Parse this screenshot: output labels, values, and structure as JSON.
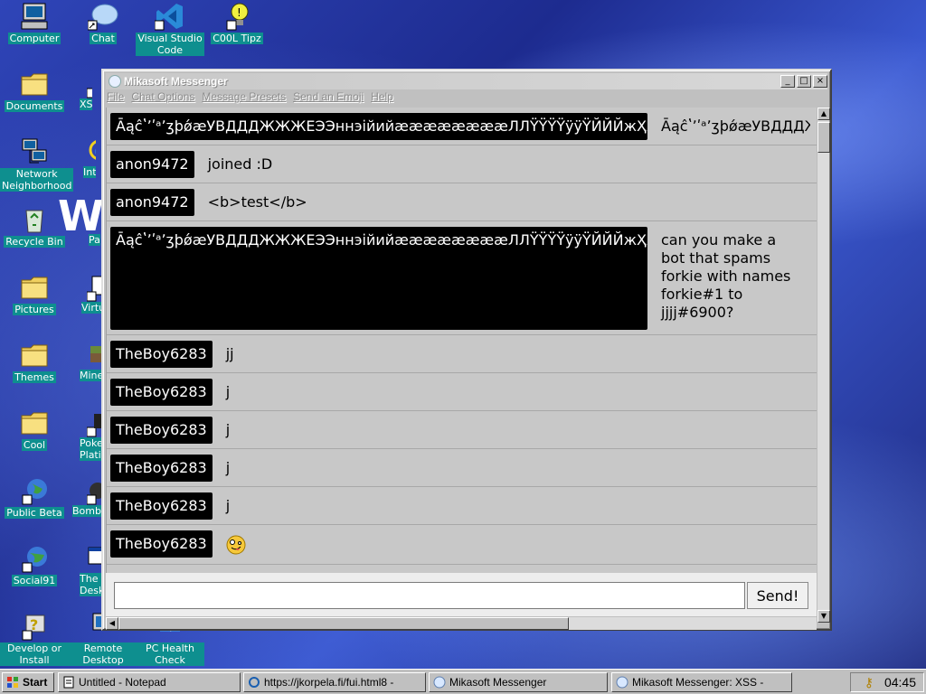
{
  "desktop": {
    "icons": [
      {
        "label": "Computer",
        "icon": "computer-icon"
      },
      {
        "label": "Chat",
        "icon": "chat-icon"
      },
      {
        "label": "Visual Studio Code",
        "icon": "vscode-icon"
      },
      {
        "label": "C00L Tipz",
        "icon": "tips-icon"
      },
      {
        "label": "Documents",
        "icon": "folder-icon"
      },
      {
        "label": "XSS",
        "icon": "chat-icon"
      },
      {
        "label": "Network Neighborhood",
        "icon": "network-icon"
      },
      {
        "label": "Inte Explo",
        "icon": "internet-explorer-icon"
      },
      {
        "label": "Recycle Bin",
        "icon": "recycle-bin-icon"
      },
      {
        "label": "Pa",
        "icon": "paint-icon"
      },
      {
        "label": "Pictures",
        "icon": "folder-icon"
      },
      {
        "label": "Virtu",
        "icon": "app-icon"
      },
      {
        "label": "Themes",
        "icon": "folder-icon"
      },
      {
        "label": "Mine",
        "icon": "minecraft-icon"
      },
      {
        "label": "Cool",
        "icon": "folder-icon"
      },
      {
        "label": "Poke Plati",
        "icon": "app-icon"
      },
      {
        "label": "Public Beta",
        "icon": "globe-icon"
      },
      {
        "label": "Bomb",
        "icon": "bomb-icon"
      },
      {
        "label": "Social91",
        "icon": "globe-icon"
      },
      {
        "label": "The Desk",
        "icon": "app-icon"
      },
      {
        "label": "Develop or Install",
        "icon": "setup-icon"
      },
      {
        "label": "Remote Desktop",
        "icon": "remote-desktop-icon"
      },
      {
        "label": "PC Health Check",
        "icon": "health-check-icon"
      }
    ]
  },
  "window": {
    "title": "Mikasoft Messenger",
    "menu": [
      "File",
      "Chat Options",
      "Message Presets",
      "Send an Emoji",
      "Help"
    ],
    "messages": [
      {
        "user": "ĀąĉʽʼʹᵃʼʒþǿæУВДДДЖЖЖЕЭЭннэійийææææææææЛЛŸŸŸŸÿÿŸЙЙЙжҲҲҲҲҲ",
        "text": "ĀąĉʽʼʹᵃʼʒþǿæУВДДДЖЖЖ"
      },
      {
        "user": "anon9472",
        "text": "joined :D"
      },
      {
        "user": "anon9472",
        "text": "<b>test</b>"
      },
      {
        "user": "ĀąĉʽʼʹᵃʼʒþǿæУВДДДЖЖЖЕЭЭннэійийææææææææЛЛŸŸŸŸÿÿŸЙЙЙжҲҲҲҲҲ",
        "text": "can you make a bot that spams forkie with names forkie#1 to jjjj#6900?"
      },
      {
        "user": "TheBoy6283",
        "text": "jj"
      },
      {
        "user": "TheBoy6283",
        "text": "j"
      },
      {
        "user": "TheBoy6283",
        "text": "j"
      },
      {
        "user": "TheBoy6283",
        "text": "j"
      },
      {
        "user": "TheBoy6283",
        "text": "j"
      },
      {
        "user": "TheBoy6283",
        "text": "",
        "emoji": "zany-face-emoji"
      }
    ],
    "input": {
      "value": "",
      "placeholder": ""
    },
    "send_label": "Send!"
  },
  "taskbar": {
    "start_label": "Start",
    "items": [
      {
        "label": "Untitled - Notepad",
        "icon": "notepad-icon"
      },
      {
        "label": "https://jkorpela.fi/fui.html8 -",
        "icon": "browser-icon"
      },
      {
        "label": "Mikasoft Messenger",
        "icon": "messenger-icon"
      },
      {
        "label": "Mikasoft Messenger: XSS -",
        "icon": "messenger-icon"
      }
    ],
    "clock": "04:45"
  }
}
